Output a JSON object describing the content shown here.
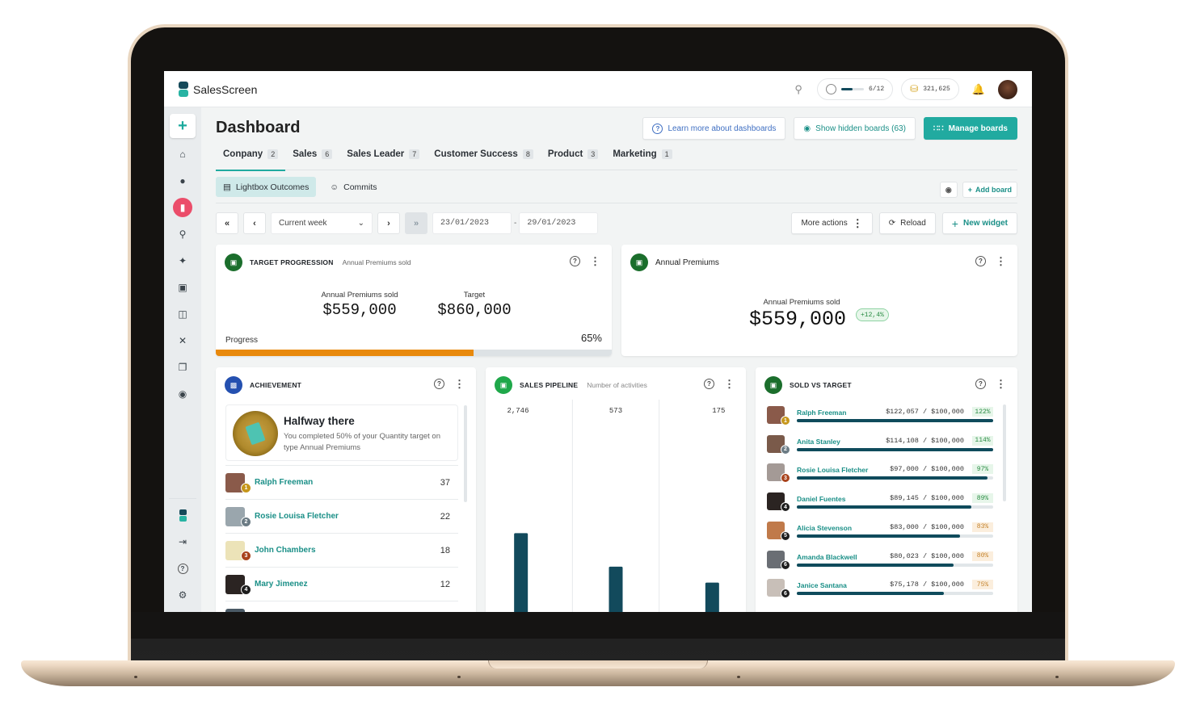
{
  "app": {
    "name": "SalesScreen"
  },
  "topbar": {
    "level_progress": "6/12",
    "level_fraction": 0.5,
    "coins": "321,625"
  },
  "sidebar": {
    "items": [
      {
        "icon": "plus-icon",
        "label": "Create"
      },
      {
        "icon": "home-icon",
        "label": "Home"
      },
      {
        "icon": "chat-icon",
        "label": "Feed"
      },
      {
        "icon": "bar-chart-icon",
        "label": "Dashboards",
        "active": true
      },
      {
        "icon": "trophy-icon",
        "label": "Competitions"
      },
      {
        "icon": "party-popper-icon",
        "label": "Celebrations"
      },
      {
        "icon": "register-icon",
        "label": "Registrations"
      },
      {
        "icon": "gift-icon",
        "label": "Rewards"
      },
      {
        "icon": "swords-icon",
        "label": "Duels"
      },
      {
        "icon": "copy-icon",
        "label": "Templates"
      },
      {
        "icon": "lightbulb-icon",
        "label": "Insights"
      }
    ],
    "bottom": [
      {
        "icon": "salesscreen-logo-icon"
      },
      {
        "icon": "collapse-icon"
      },
      {
        "icon": "help-icon"
      },
      {
        "icon": "settings-icon"
      }
    ]
  },
  "header": {
    "title": "Dashboard",
    "learn_more": "Learn more about dashboards",
    "show_hidden": "Show hidden boards (63)",
    "manage": "Manage boards"
  },
  "tabs": [
    {
      "label": "Conpany",
      "count": "2",
      "active": true
    },
    {
      "label": "Sales",
      "count": "6"
    },
    {
      "label": "Sales Leader",
      "count": "7"
    },
    {
      "label": "Customer Success",
      "count": "8"
    },
    {
      "label": "Product",
      "count": "3"
    },
    {
      "label": "Marketing",
      "count": "1"
    }
  ],
  "boards": [
    {
      "label": "Lightbox Outcomes",
      "active": true
    },
    {
      "label": "Commits"
    }
  ],
  "board_actions": {
    "add_board": "Add board"
  },
  "toolbar": {
    "period": "Current week",
    "date_from": "23/01/2023",
    "date_sep": "-",
    "date_to": "29/01/2023",
    "more_actions": "More actions",
    "reload": "Reload",
    "new_widget": "New widget"
  },
  "widgets": {
    "target_progression": {
      "title": "TARGET PROGRESSION",
      "subtitle": "Annual Premiums sold",
      "sold_label": "Annual Premiums sold",
      "sold_value": "$559,000",
      "target_label": "Target",
      "target_value": "$860,000",
      "progress_label": "Progress",
      "progress_text": "65%",
      "progress": 0.65
    },
    "annual_premiums": {
      "title": "Annual Premiums",
      "label": "Annual Premiums sold",
      "value": "$559,000",
      "change": "+12,4%"
    },
    "achievement": {
      "title": "ACHIEVEMENT",
      "heading": "Halfway there",
      "description": "You completed 50% of your Quantity target on type Annual Premiums",
      "leaders": [
        {
          "rank": "1",
          "name": "Ralph Freeman",
          "value": "37",
          "rank_color": "#c6961b"
        },
        {
          "rank": "2",
          "name": "Rosie Louisa Fletcher",
          "value": "22",
          "rank_color": "#6b7b84"
        },
        {
          "rank": "3",
          "name": "John Chambers",
          "value": "18",
          "rank_color": "#a8421b"
        },
        {
          "rank": "4",
          "name": "Mary Jimenez",
          "value": "12",
          "rank_color": "#1d1d1d"
        }
      ]
    },
    "sales_pipeline": {
      "title": "SALES PIPELINE",
      "subtitle": "Number of activities"
    },
    "sold_vs_target": {
      "title": "SOLD VS TARGET",
      "rows": [
        {
          "rank": "1",
          "name": "Ralph Freeman",
          "amount": "$122,057 / $100,000",
          "pct": "122%",
          "ratio": 1.22,
          "tone": "green"
        },
        {
          "rank": "2",
          "name": "Anita Stanley",
          "amount": "$114,108 / $100,000",
          "pct": "114%",
          "ratio": 1.14,
          "tone": "green"
        },
        {
          "rank": "3",
          "name": "Rosie Louisa Fletcher",
          "amount": "$97,000 / $100,000",
          "pct": "97%",
          "ratio": 0.97,
          "tone": "green"
        },
        {
          "rank": "4",
          "name": "Daniel Fuentes",
          "amount": "$89,145 / $100,000",
          "pct": "89%",
          "ratio": 0.89,
          "tone": "green"
        },
        {
          "rank": "5",
          "name": "Alicia Stevenson",
          "amount": "$83,000 / $100,000",
          "pct": "83%",
          "ratio": 0.83,
          "tone": "orange"
        },
        {
          "rank": "6",
          "name": "Amanda Blackwell",
          "amount": "$80,023 / $100,000",
          "pct": "80%",
          "ratio": 0.8,
          "tone": "orange"
        },
        {
          "rank": "6",
          "name": "Janice Santana",
          "amount": "$75,178 / $100,000",
          "pct": "75%",
          "ratio": 0.75,
          "tone": "orange"
        }
      ]
    }
  },
  "colors": {
    "accent": "#21aaa0",
    "progress": "#e8890c",
    "bar": "#124a5c",
    "active_nav": "#eb4d6a"
  },
  "chart_data": {
    "type": "bar",
    "title": "SALES PIPELINE",
    "subtitle": "Number of activities",
    "categories": [
      "",
      "",
      ""
    ],
    "values": [
      2746,
      573,
      175
    ],
    "value_labels": [
      "2,746",
      "573",
      "175"
    ],
    "xlabel": "",
    "ylabel": "",
    "grid": false
  }
}
